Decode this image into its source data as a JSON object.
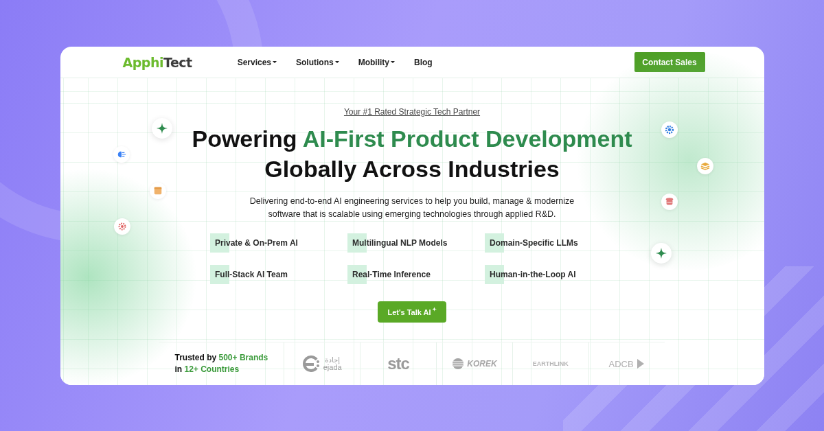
{
  "logo": {
    "first": "Apphi",
    "second": "Tect"
  },
  "nav": [
    {
      "label": "Services",
      "dropdown": true
    },
    {
      "label": "Solutions",
      "dropdown": true
    },
    {
      "label": "Mobility",
      "dropdown": true
    },
    {
      "label": "Blog",
      "dropdown": false
    }
  ],
  "cta_top": "Contact Sales",
  "hero": {
    "tagline": "Your #1 Rated Strategic Tech Partner",
    "headline_lead": "Powering ",
    "headline_highlight": "AI-First Product Development",
    "headline_line2": "Globally Across Industries",
    "description": "Delivering end-to-end AI engineering services to help you build, manage & modernize software that is scalable using emerging technologies through applied R&D.",
    "features": [
      "Private & On-Prem AI",
      "Multilingual NLP Models",
      "Domain-Specific LLMs",
      "Full-Stack AI Team",
      "Real-Time Inference",
      "Human-in-the-Loop AI"
    ],
    "button": "Let's Talk AI"
  },
  "trust": {
    "lead": "Trusted by ",
    "brands": "500+ Brands",
    "line2_lead": "in ",
    "countries": "12+ Countries"
  },
  "clients": [
    {
      "name": "ejada",
      "kind": "ejada",
      "script": "إجادة"
    },
    {
      "name": "stc",
      "kind": "stc"
    },
    {
      "name": "KOREK",
      "kind": "korek"
    },
    {
      "name": "EARTHLINK",
      "kind": "earthlink"
    },
    {
      "name": "ADCB",
      "kind": "adcb"
    }
  ]
}
